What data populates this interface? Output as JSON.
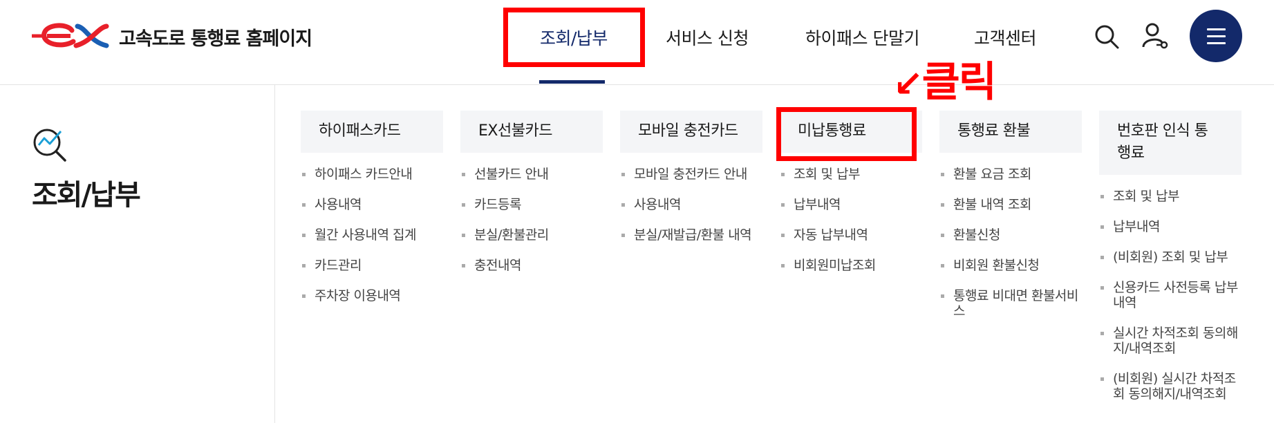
{
  "site": {
    "title": "고속도로 통행료 홈페이지"
  },
  "nav": [
    {
      "label": "조회/납부"
    },
    {
      "label": "서비스 신청"
    },
    {
      "label": "하이패스 단말기"
    },
    {
      "label": "고객센터"
    }
  ],
  "section": {
    "title": "조회/납부"
  },
  "annotation": {
    "arrow": "↙",
    "text": "클릭"
  },
  "columns": [
    {
      "title": "하이패스카드",
      "items": [
        "하이패스 카드안내",
        "사용내역",
        "월간 사용내역 집계",
        "카드관리",
        "주차장 이용내역"
      ]
    },
    {
      "title": "EX선불카드",
      "items": [
        "선불카드 안내",
        "카드등록",
        "분실/환불관리",
        "충전내역"
      ]
    },
    {
      "title": "모바일 충전카드",
      "items": [
        "모바일 충전카드 안내",
        "사용내역",
        "분실/재발급/환불 내역"
      ]
    },
    {
      "title": "미납통행료",
      "items": [
        "조회 및 납부",
        "납부내역",
        "자동 납부내역",
        "비회원미납조회"
      ]
    },
    {
      "title": "통행료 환불",
      "items": [
        "환불 요금 조회",
        "환불 내역 조회",
        "환불신청",
        "비회원 환불신청",
        "통행료 비대면 환불서비스"
      ]
    },
    {
      "title": "번호판 인식 통행료",
      "items": [
        "조회 및 납부",
        "납부내역",
        "(비회원) 조회 및 납부",
        "신용카드 사전등록 납부내역",
        "실시간 차적조회 동의해지/내역조회",
        "(비회원) 실시간 차적조회 동의해지/내역조회"
      ]
    }
  ],
  "colors": {
    "accent": "#13296a",
    "highlight": "#ff0000",
    "logo_red": "#e8202a",
    "logo_blue": "#1a5fb4"
  },
  "icons": {
    "search": "search-icon",
    "login": "user-key-icon",
    "menu": "hamburger-menu-icon",
    "section": "magnify-chart-icon"
  }
}
